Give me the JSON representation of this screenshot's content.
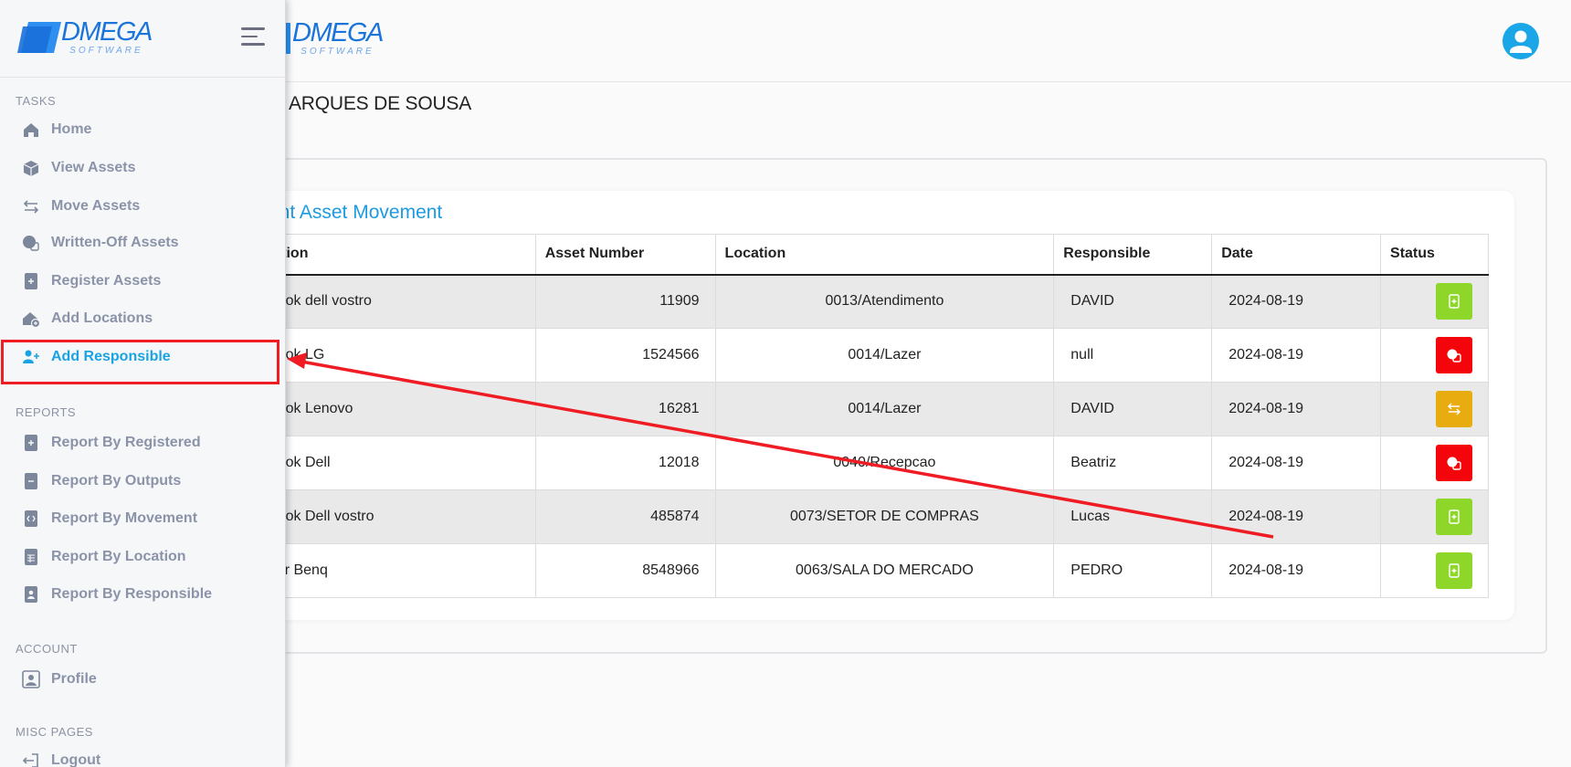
{
  "brand": {
    "name": "DMEGA",
    "sub": "SOFTWARE",
    "color": "#1a74d9"
  },
  "header": {
    "page_title": "ARQUES DE SOUSA",
    "avatar_icon": "user-icon"
  },
  "card": {
    "title": "ent Asset Movement"
  },
  "table": {
    "columns": [
      "escription",
      "Asset Number",
      "Location",
      "Responsible",
      "Date",
      "Status"
    ],
    "rows": [
      {
        "description": "Notebook dell vostro",
        "asset_number": "11909",
        "location": "0013/Atendimento",
        "responsible": "DAVID",
        "date": "2024-08-19",
        "status": "register",
        "status_color": "#8ed62a"
      },
      {
        "description": "Notebook LG",
        "asset_number": "1524566",
        "location": "0014/Lazer",
        "responsible": "null",
        "date": "2024-08-19",
        "status": "written-off",
        "status_color": "#f4050c"
      },
      {
        "description": "Notebook Lenovo",
        "asset_number": "16281",
        "location": "0014/Lazer",
        "responsible": "DAVID",
        "date": "2024-08-19",
        "status": "move",
        "status_color": "#e8ac10"
      },
      {
        "description": "Notebook Dell",
        "asset_number": "12018",
        "location": "0040/Recepcao",
        "responsible": "Beatriz",
        "date": "2024-08-19",
        "status": "written-off",
        "status_color": "#f4050c"
      },
      {
        "description": "Notebook Dell vostro",
        "asset_number": "485874",
        "location": "0073/SETOR DE COMPRAS",
        "responsible": "Lucas",
        "date": "2024-08-19",
        "status": "register",
        "status_color": "#8ed62a"
      },
      {
        "description": "Projetor Benq",
        "asset_number": "8548966",
        "location": "0063/SALA DO MERCADO",
        "responsible": "PEDRO",
        "date": "2024-08-19",
        "status": "register",
        "status_color": "#8ed62a"
      }
    ]
  },
  "sidebar": {
    "sections": {
      "tasks": "TASKS",
      "reports": "REPORTS",
      "account": "ACCOUNT",
      "misc": "MISC PAGES"
    },
    "tasks": [
      {
        "label": "Home",
        "icon": "home-icon"
      },
      {
        "label": "View Assets",
        "icon": "box-icon"
      },
      {
        "label": "Move Assets",
        "icon": "swap-arrows-icon"
      },
      {
        "label": "Written-Off Assets",
        "icon": "written-off-icon"
      },
      {
        "label": "Register Assets",
        "icon": "file-plus-icon"
      },
      {
        "label": "Add Locations",
        "icon": "house-plus-icon"
      },
      {
        "label": "Add Responsible",
        "icon": "user-plus-icon",
        "active": true
      }
    ],
    "reports": [
      {
        "label": "Report By Registered",
        "icon": "file-plus-icon"
      },
      {
        "label": "Report By Outputs",
        "icon": "file-minus-icon"
      },
      {
        "label": "Report By Movement",
        "icon": "file-code-icon"
      },
      {
        "label": "Report By Location",
        "icon": "file-spreadsheet-icon"
      },
      {
        "label": "Report By Responsible",
        "icon": "file-person-icon"
      }
    ],
    "account": [
      {
        "label": "Profile",
        "icon": "person-badge-icon"
      }
    ],
    "misc": [
      {
        "label": "Logout",
        "icon": "logout-icon"
      }
    ]
  },
  "colors": {
    "accent": "#1aa3e4",
    "annotation": "#ef1c24"
  }
}
